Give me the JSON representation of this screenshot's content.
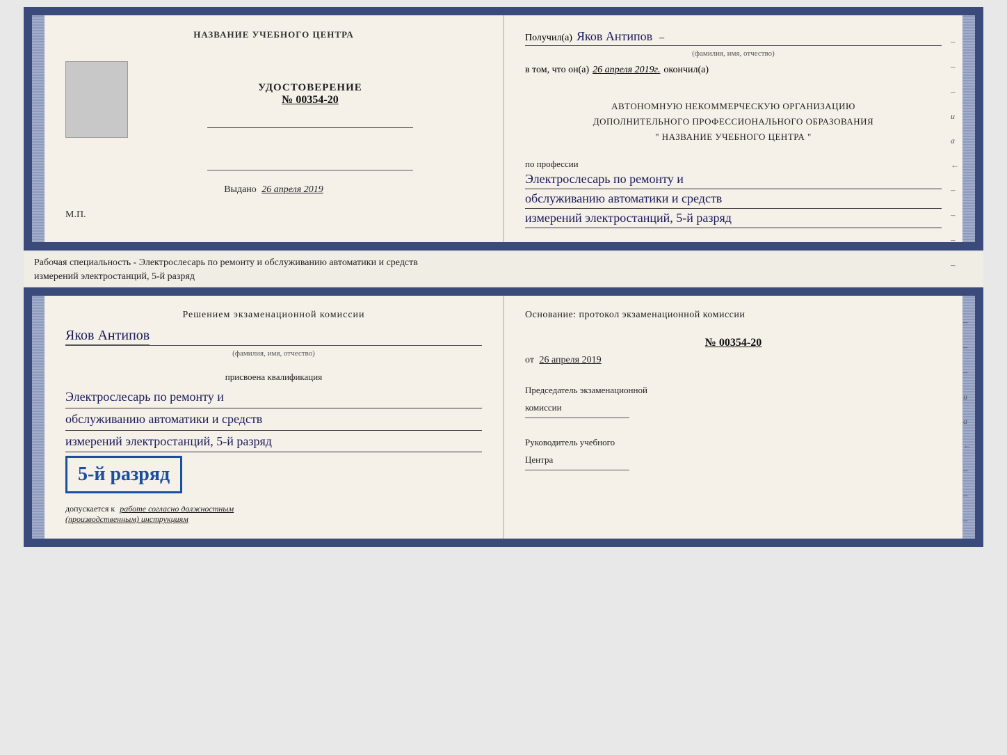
{
  "document": {
    "org_name": "НАЗВАНИЕ УЧЕБНОГО ЦЕНТРА",
    "cert_label": "УДОСТОВЕРЕНИЕ",
    "cert_number": "№ 00354-20",
    "issued_prefix": "Выдано",
    "issued_date": "26 апреля 2019",
    "mp_label": "М.П.",
    "right_top": {
      "received_prefix": "Получил(а)",
      "person_name": "Яков Антипов",
      "name_subtitle": "(фамилия, имя, отчество)",
      "confirm_prefix": "в том, что он(а)",
      "confirm_date": "26 апреля 2019г.",
      "confirm_suffix": "окончил(а)",
      "org_block_line1": "АВТОНОМНУЮ НЕКОММЕРЧЕСКУЮ ОРГАНИЗАЦИЮ",
      "org_block_line2": "ДОПОЛНИТЕЛЬНОГО ПРОФЕССИОНАЛЬНОГО ОБРАЗОВАНИЯ",
      "org_block_line3": "\"   НАЗВАНИЕ УЧЕБНОГО ЦЕНТРА   \"",
      "profession_label": "по профессии",
      "profession_line1": "Электрослесарь по ремонту и",
      "profession_line2": "обслуживанию автоматики и средств",
      "profession_line3": "измерений электростанций, 5-й разряд"
    },
    "between_text": "Рабочая специальность - Электрослесарь по ремонту и обслуживанию автоматики и средств\nизмерений электростанций, 5-й разряд",
    "bottom_left": {
      "decision_text": "Решением экзаменационной комиссии",
      "person_name": "Яков Антипов",
      "name_subtitle": "(фамилия, имя, отчество)",
      "qualification_label": "присвоена квалификация",
      "qual_line1": "Электрослесарь по ремонту и",
      "qual_line2": "обслуживанию автоматики и средств",
      "qual_line3": "измерений электростанций, 5-й разряд",
      "rank_badge": "5-й разряд",
      "allowed_prefix": "допускается к",
      "allowed_italic": "работе согласно должностным",
      "allowed_italic2": "(производственным) инструкциям"
    },
    "bottom_right": {
      "basis_text": "Основание: протокол экзаменационной комиссии",
      "protocol_number": "№ 00354-20",
      "date_prefix": "от",
      "date_value": "26 апреля 2019",
      "chairman_title_line1": "Председатель экзаменационной",
      "chairman_title_line2": "комиссии",
      "director_title_line1": "Руководитель учебного",
      "director_title_line2": "Центра"
    }
  }
}
